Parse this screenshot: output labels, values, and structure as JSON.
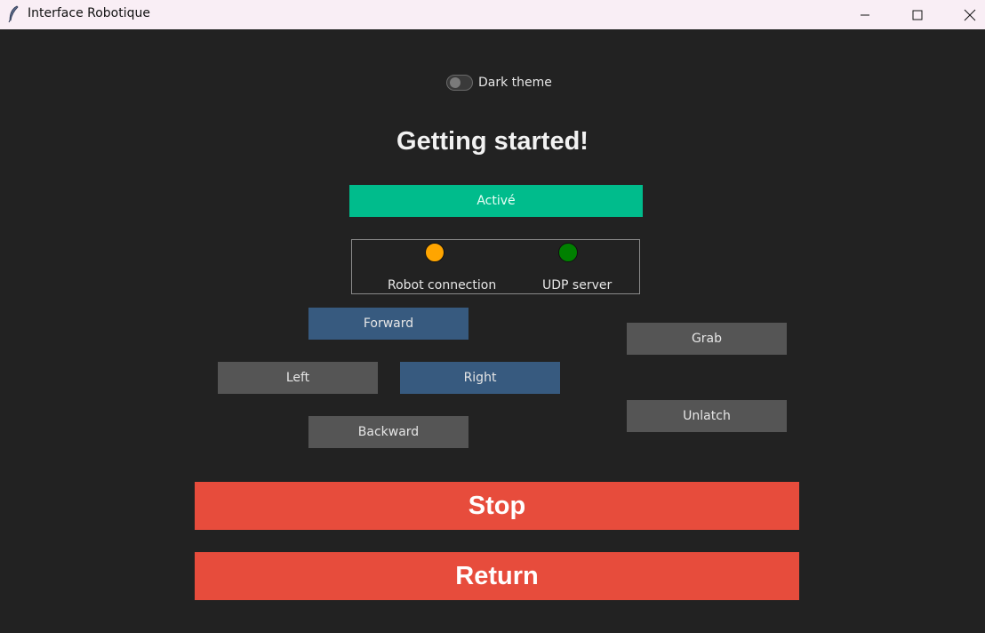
{
  "window": {
    "title": "Interface Robotique"
  },
  "theme_toggle": {
    "label": "Dark theme",
    "checked": false
  },
  "heading": "Getting started!",
  "status_button": {
    "label": "Activé",
    "color": "#00bc8c"
  },
  "indicators": [
    {
      "label": "Robot connection",
      "color": "#ffa500"
    },
    {
      "label": "UDP server",
      "color": "#008000"
    }
  ],
  "controls": {
    "forward": "Forward",
    "left": "Left",
    "right": "Right",
    "backward": "Backward",
    "grab": "Grab",
    "unlatch": "Unlatch"
  },
  "actions": {
    "stop": "Stop",
    "return": "Return"
  },
  "colors": {
    "background": "#222222",
    "primary_blue": "#375a7f",
    "secondary_grey": "#555555",
    "danger_red": "#e74c3c"
  }
}
